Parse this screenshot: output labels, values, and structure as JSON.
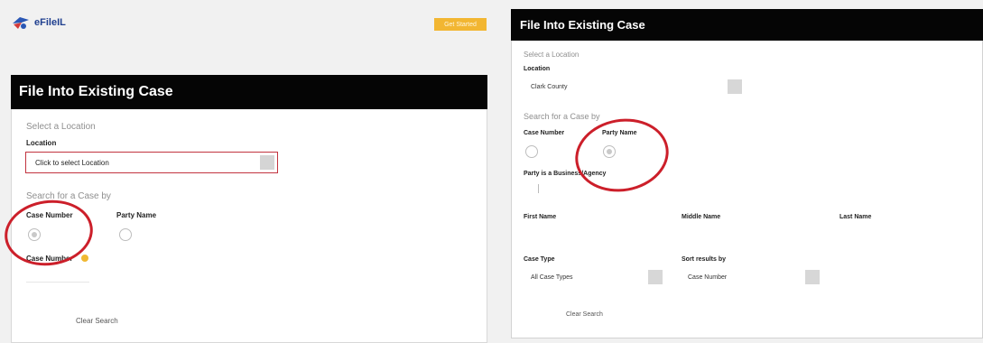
{
  "header": {
    "logo_text": "eFileIL",
    "getting_started": "Get Started"
  },
  "left_panel": {
    "title": "File Into Existing Case",
    "select_location_heading": "Select a Location",
    "location_label": "Location",
    "location_placeholder": "Click to select Location",
    "search_heading": "Search for a Case by",
    "case_number_option": "Case Number",
    "party_name_option": "Party Name",
    "case_number_field_label": "Case Number",
    "clear_search": "Clear Search"
  },
  "right_panel": {
    "title": "File Into Existing Case",
    "select_location_heading": "Select a Location",
    "location_label": "Location",
    "location_value": "Clark County",
    "search_heading": "Search for a Case by",
    "case_number_option": "Case Number",
    "party_name_option": "Party Name",
    "business_label": "Party is a Business/Agency",
    "first_name_label": "First Name",
    "middle_name_label": "Middle Name",
    "last_name_label": "Last Name",
    "case_type_label": "Case Type",
    "case_type_value": "All Case Types",
    "sort_label": "Sort results by",
    "sort_value": "Case Number",
    "clear_search": "Clear Search"
  },
  "colors": {
    "header_bar": "#050505",
    "highlight_circle": "#cc1f2a",
    "accent": "#f2b632"
  }
}
